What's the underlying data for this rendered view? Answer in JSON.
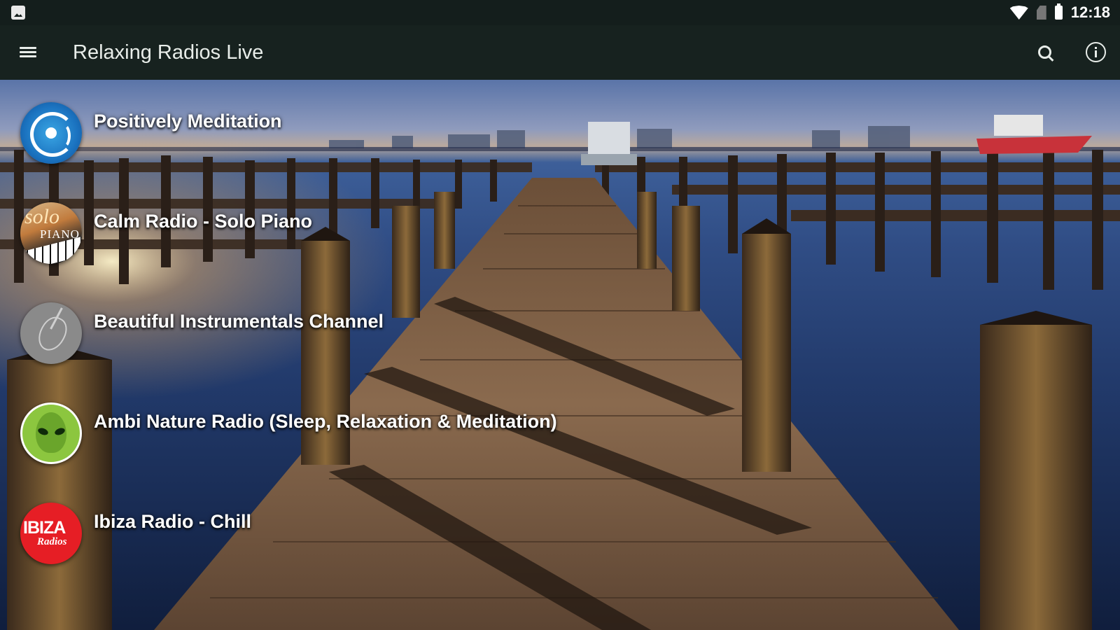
{
  "status_bar": {
    "time": "12:18",
    "icons": [
      "image-notification-icon",
      "wifi-icon",
      "no-sim-icon",
      "battery-icon"
    ]
  },
  "app_bar": {
    "title": "Relaxing Radios Live",
    "actions": [
      "search-icon",
      "info-icon"
    ]
  },
  "stations": [
    {
      "name": "Positively Meditation"
    },
    {
      "name": "Calm Radio - Solo Piano",
      "logo_text": [
        "solo",
        "PIANO"
      ]
    },
    {
      "name": "Beautiful Instrumentals Channel"
    },
    {
      "name": "Ambi Nature Radio (Sleep, Relaxation & Meditation)"
    },
    {
      "name": "Ibiza Radio - Chill",
      "logo_text": [
        "IBIZA",
        "Radios"
      ]
    }
  ],
  "colors": {
    "status_bar_bg": "#141e1c",
    "app_bar_bg": "#17221f",
    "text_primary": "#ffffff"
  }
}
